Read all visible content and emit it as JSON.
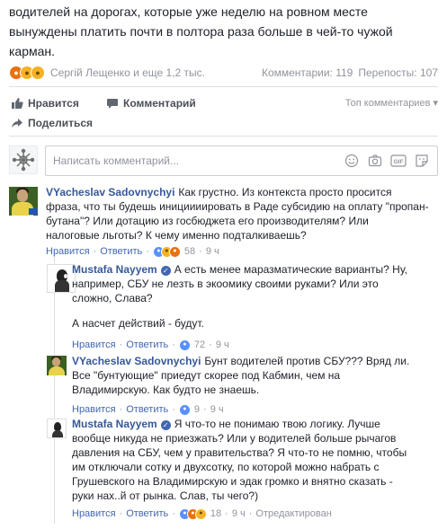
{
  "post": {
    "text_lines": [
      "водителей на дорогах, которые уже неделю на ровном месте",
      "вынуждены платить почти в полтора раза больше в чей-то чужой",
      "карман."
    ]
  },
  "reactions": {
    "emoji_icons": [
      "angry-reaction",
      "haha-reaction",
      "sad-reaction"
    ],
    "reactors_text": "Сергій Лещенко и еще 1,2 тыс.",
    "comments_count": "Комментарии: 119",
    "shares_count": "Перепосты: 107"
  },
  "actions": {
    "like_label": "Нравится",
    "comment_label": "Комментарий",
    "share_label": "Поделиться",
    "sort_label": "Топ комментариев ▾"
  },
  "composer": {
    "placeholder": "Написать комментарий..."
  },
  "comments": [
    {
      "author": "VYacheslav Sadovnychyi",
      "lines": [
        "Как грустно. Из контекста просто просится",
        "фраза, что ты будешь инициииировать в Раде субсидию на оплату \"пропан-",
        "бутана\"? Или дотацию из госбюджета его производителям? Или",
        "налоговые льготы? К чему именно подталкиваешь?"
      ],
      "like": "Нравится",
      "reply": "Ответить",
      "reactions_count": "58",
      "time": "9 ч"
    },
    {
      "author": "Mustafa Nayyem",
      "lines": [
        "А есть менее маразматические варианты? Ну,",
        "например, СБУ не лезть в экоомику своими руками? Или это",
        "сложно, Слава?"
      ],
      "lines2": [
        "А насчет действий - будут."
      ],
      "like": "Нравится",
      "reply": "Ответить",
      "reactions_count": "72",
      "time": "9 ч"
    },
    {
      "author": "VYacheslav Sadovnychyi",
      "lines": [
        "Бунт водителей против СБУ??? Вряд ли.",
        "Все \"бунтующие\" приедут скорее под Кабмин, чем на",
        "Владимирскую. Как будто не знаешь."
      ],
      "like": "Нравится",
      "reply": "Ответить",
      "reactions_count": "9",
      "time": "9 ч"
    },
    {
      "author": "Mustafa Nayyem",
      "lines": [
        "Я что-то не понимаю твою логику. Лучше",
        "вообще никуда не приезжать? Или у водителей больше рычагов",
        "давления на СБУ, чем у правительства? Я что-то не помню, чтобы",
        "им отключали сотку и двухсотку, по которой можно набрать с",
        "Грушевского на Владимирскую и эдак громко и внятно сказать -",
        "руки нах..й от рынка. Слав, ты чего?)"
      ],
      "like": "Нравится",
      "reply": "Ответить",
      "reactions_count": "18",
      "time": "9 ч",
      "edited": "Отредактирован"
    }
  ]
}
